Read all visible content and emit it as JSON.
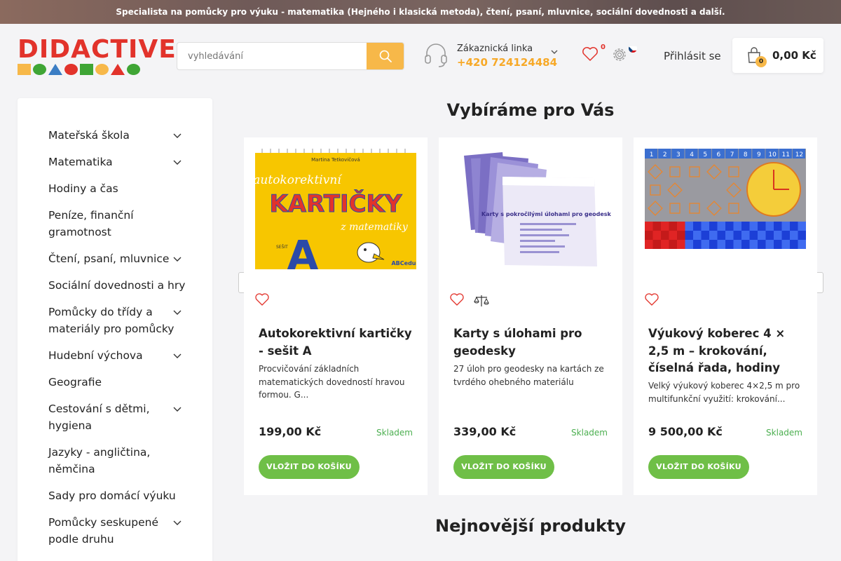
{
  "topbar": {
    "text": "Specialista na pomůcky pro výuku - matematika (Hejného i klasická metoda), čtení, psaní, mluvnice, sociální dovednosti a další."
  },
  "header": {
    "logo_text": "DIDACTIVE",
    "search": {
      "placeholder": "vyhledávání",
      "value": ""
    },
    "hotline": {
      "label": "Zákaznická linka",
      "phone": "+420 724124484"
    },
    "favorites_count": "0",
    "login_label": "Přihlásit se",
    "cart": {
      "count": "0",
      "total": "0,00 Kč"
    }
  },
  "sidebar": {
    "categories": [
      {
        "label": "Mateřská škola",
        "has_children": true
      },
      {
        "label": "Matematika",
        "has_children": true
      },
      {
        "label": "Hodiny a čas",
        "has_children": false
      },
      {
        "label": "Peníze, finanční gramotnost",
        "has_children": false
      },
      {
        "label": "Čtení, psaní, mluvnice",
        "has_children": true
      },
      {
        "label": "Sociální dovednosti a hry",
        "has_children": false
      },
      {
        "label": "Pomůcky do třídy a materiály pro pomůcky",
        "has_children": true
      },
      {
        "label": "Hudební výchova",
        "has_children": true
      },
      {
        "label": "Geografie",
        "has_children": false
      },
      {
        "label": "Cestování s dětmi, hygiena",
        "has_children": true
      },
      {
        "label": "Jazyky - angličtina, němčina",
        "has_children": false
      },
      {
        "label": "Sady pro domácí výuku",
        "has_children": false
      },
      {
        "label": "Pomůcky seskupené podle druhu",
        "has_children": true
      }
    ]
  },
  "recommended": {
    "title": "Vybíráme pro Vás",
    "products": [
      {
        "name": "Autokorektivní kartičky - sešit A",
        "description": "Procvičování základních matematických dovedností hravou formou. G...",
        "price": "199,00 Kč",
        "stock": "Skladem",
        "button": "VLOŽIT DO KOŠÍKU",
        "image": {
          "author": "Martina Tetkovičová",
          "line1": "autokorektivní",
          "line2": "KARTIČKY",
          "line3": "z matematiky",
          "letter": "A",
          "series": "SEŠIT",
          "brand": "ABCedu"
        }
      },
      {
        "name": "Karty s úlohami pro geodesky",
        "description": "27 úloh pro geodesky na kartách ze tvrdého ohebného materiálu",
        "price": "339,00 Kč",
        "stock": "Skladem",
        "button": "VLOŽIT DO KOŠÍKU",
        "image": {
          "card_title": "Karty s pokročilými úlohami pro geodesky"
        }
      },
      {
        "name": "Výukový koberec 4 × 2,5 m – krokování, číselná řada, hodiny",
        "description": "Velký výukový koberec 4×2,5 m pro multifunkční využití: krokování...",
        "price": "9 500,00 Kč",
        "stock": "Skladem",
        "button": "VLOŽIT DO KOŠÍKU",
        "image": {
          "numbers": [
            "1",
            "2",
            "3",
            "4",
            "5",
            "6",
            "7",
            "8",
            "9",
            "10",
            "11",
            "12"
          ]
        }
      }
    ]
  },
  "newest": {
    "title": "Nejnovější produkty"
  },
  "colors": {
    "accent": "#f7b849",
    "phone": "#f7a928",
    "button": "#6fbf47",
    "stock": "#4caf50",
    "logo": "#e2332b"
  }
}
